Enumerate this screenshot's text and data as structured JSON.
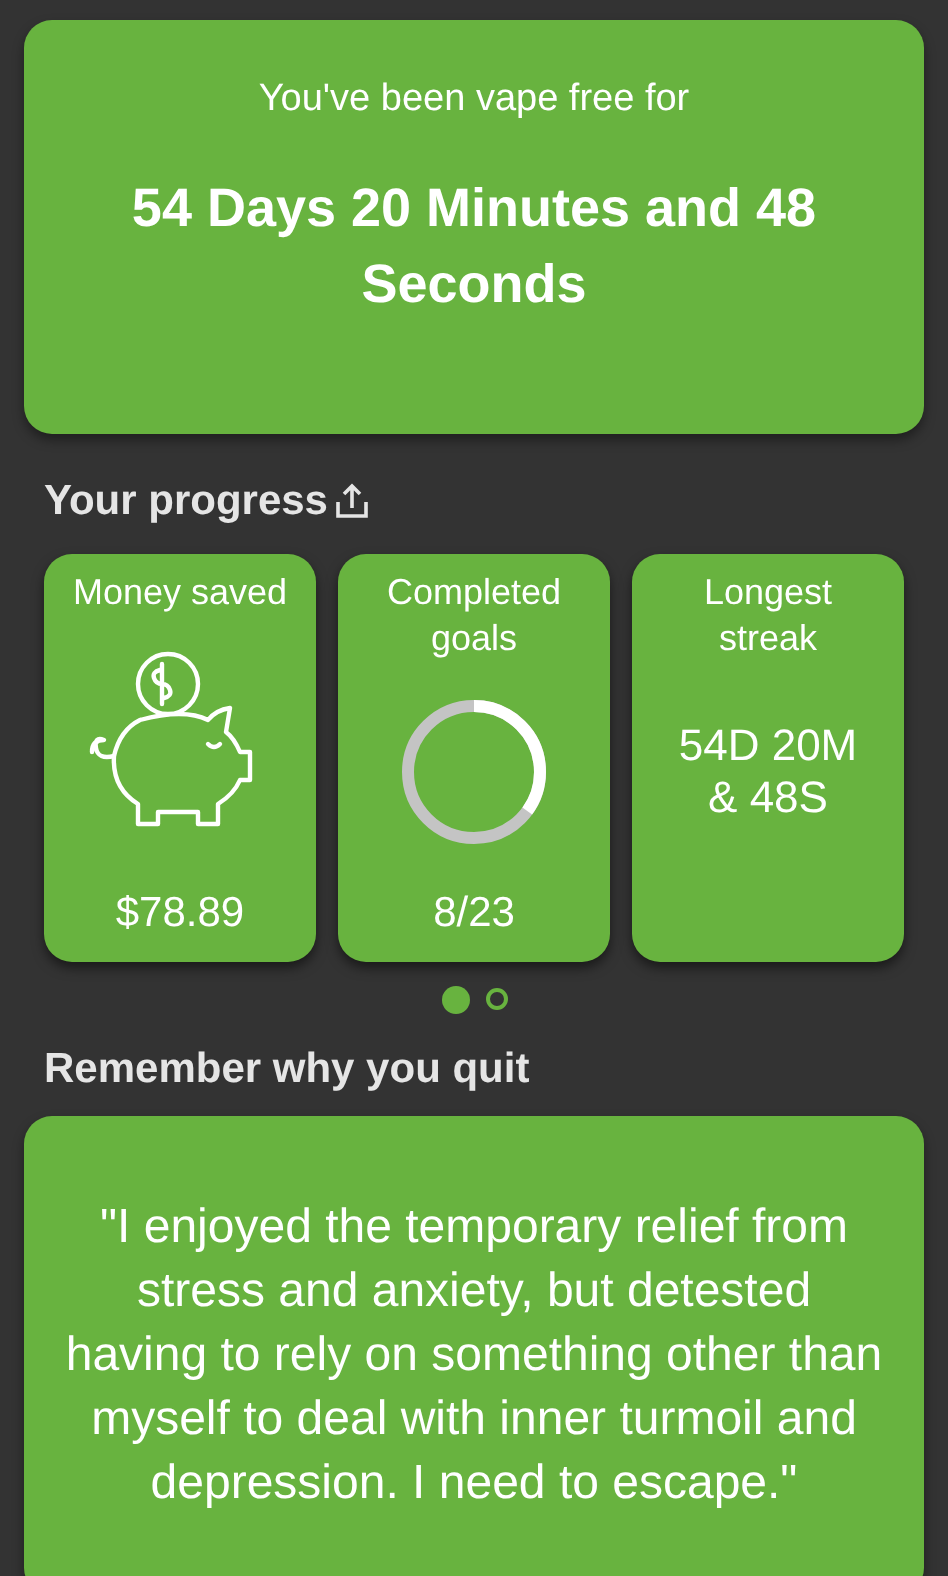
{
  "header": {
    "subtitle": "You've been vape free for",
    "duration": "54 Days 20 Minutes and 48 Seconds"
  },
  "progress": {
    "title": "Your progress",
    "cards": [
      {
        "kind": "piggy",
        "label": "Money saved",
        "value": "$78.89"
      },
      {
        "kind": "ring",
        "label": "Completed goals",
        "value": "8/23",
        "level": 0.35
      },
      {
        "kind": "text",
        "label": "Longest streak",
        "value": "54D 20M & 48S"
      }
    ],
    "pages": [
      {
        "selected": true
      },
      {
        "selected": false
      }
    ]
  },
  "reason": {
    "title": "Remember why you quit",
    "quote": "\"I enjoyed the temporary relief from stress and anxiety, but detested having to rely on something other than myself to deal with inner turmoil and depression. I need to escape.\""
  }
}
